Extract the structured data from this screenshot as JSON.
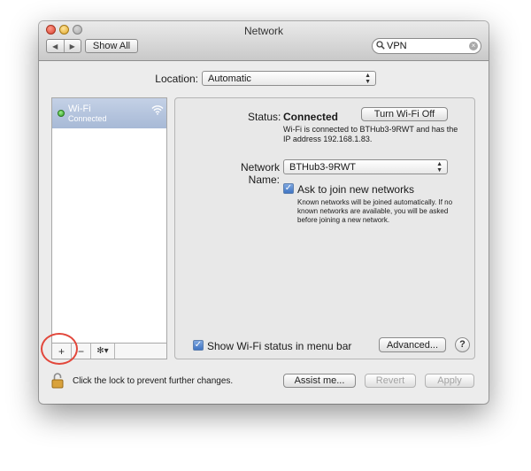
{
  "window": {
    "title": "Network"
  },
  "toolbar": {
    "back_glyph": "◀",
    "forward_glyph": "▶",
    "show_all_label": "Show All",
    "search_value": "VPN",
    "search_icon": "magnifier-icon",
    "clear_glyph": "×"
  },
  "location": {
    "label": "Location:",
    "value": "Automatic"
  },
  "sidebar": {
    "services": [
      {
        "name": "Wi-Fi",
        "status": "Connected",
        "status_color": "#2d9b22",
        "icon": "wifi-icon"
      }
    ],
    "tools": {
      "add": "+",
      "remove": "−",
      "gear": "✻▾"
    }
  },
  "detail": {
    "status_label": "Status:",
    "status_value": "Connected",
    "turn_off_label": "Turn Wi-Fi Off",
    "status_detail": "Wi-Fi is connected to BTHub3-9RWT and has the IP address 192.168.1.83.",
    "network_name_label": "Network Name:",
    "network_name_value": "BTHub3-9RWT",
    "ask_label": "Ask to join new networks",
    "ask_checked": true,
    "ask_detail": "Known networks will be joined automatically. If no known networks are available, you will be asked before joining a new network.",
    "show_status_label": "Show Wi-Fi status in menu bar",
    "show_status_checked": true,
    "advanced_label": "Advanced...",
    "help_label": "?"
  },
  "footer": {
    "lock_text": "Click the lock to prevent further changes.",
    "assist_label": "Assist me...",
    "revert_label": "Revert",
    "apply_label": "Apply"
  },
  "colors": {
    "highlight_circle": "#e2473b",
    "selection": "#a7b9d6",
    "checkbox": "#3f74c3"
  }
}
